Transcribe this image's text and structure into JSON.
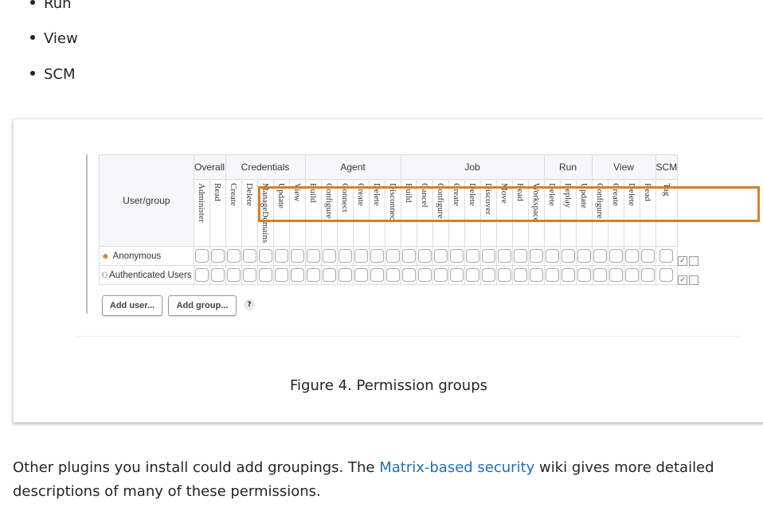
{
  "bullets": [
    "Run",
    "View",
    "SCM"
  ],
  "matrix": {
    "user_group_header": "User/group",
    "groups": [
      {
        "label": "Overall",
        "span": 2
      },
      {
        "label": "Credentials",
        "span": 5
      },
      {
        "label": "Agent",
        "span": 6
      },
      {
        "label": "Job",
        "span": 9
      },
      {
        "label": "Run",
        "span": 3
      },
      {
        "label": "View",
        "span": 4
      },
      {
        "label": "SCM",
        "span": 1
      }
    ],
    "permissions": [
      "Administer",
      "Read",
      "Create",
      "Delete",
      "ManageDomains",
      "Update",
      "View",
      "Build",
      "Configure",
      "Connect",
      "Create",
      "Delete",
      "Disconnect",
      "Build",
      "Cancel",
      "Configure",
      "Create",
      "Delete",
      "Discover",
      "Move",
      "Read",
      "Workspace",
      "Delete",
      "Replay",
      "Update",
      "Configure",
      "Create",
      "Delete",
      "Read",
      "Tag"
    ],
    "users": [
      {
        "name": "Anonymous",
        "icon": "user-icon"
      },
      {
        "name": "Authenticated Users",
        "icon": "group-icon"
      }
    ],
    "add_user_label": "Add user...",
    "add_group_label": "Add group...",
    "help_label": "?",
    "highlight_color": "#d77f28"
  },
  "caption": "Figure 4. Permission groups",
  "paragraph": {
    "before_link": "Other plugins you install could add groupings. The ",
    "link_text": "Matrix-based security",
    "after_link": " wiki gives more detailed descriptions of many of these permissions."
  }
}
